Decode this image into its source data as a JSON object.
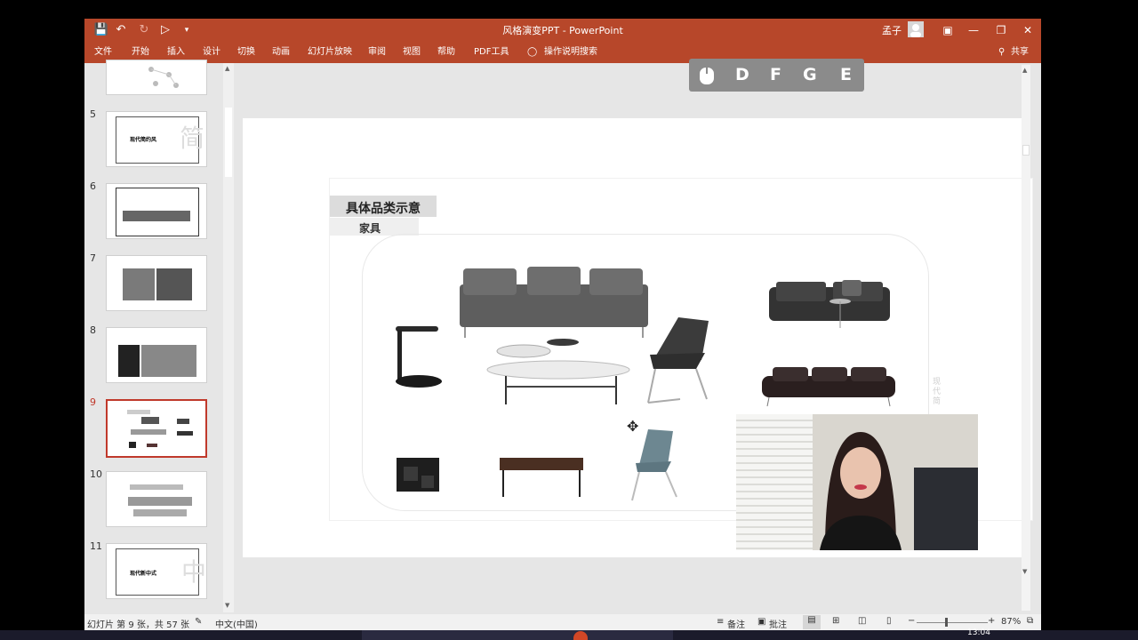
{
  "app": {
    "title": "风格演变PPT  -  PowerPoint",
    "user": "孟子",
    "share": "共享",
    "tell_me": "操作说明搜索"
  },
  "ribbon_tabs": [
    "文件",
    "开始",
    "插入",
    "设计",
    "切换",
    "动画",
    "幻灯片放映",
    "审阅",
    "视图",
    "帮助",
    "PDF工具"
  ],
  "thumbnails": [
    {
      "num": "",
      "title": ""
    },
    {
      "num": "5",
      "title": "现代简约风"
    },
    {
      "num": "6",
      "title": ""
    },
    {
      "num": "7",
      "title": ""
    },
    {
      "num": "8",
      "title": ""
    },
    {
      "num": "9",
      "title": ""
    },
    {
      "num": "10",
      "title": ""
    },
    {
      "num": "11",
      "title": "现代新中式"
    }
  ],
  "slide": {
    "heading": "具体品类示意",
    "subheading": "家具"
  },
  "key_overlay": {
    "keys": [
      "D",
      "F",
      "G",
      "E"
    ]
  },
  "statusbar": {
    "slide_info": "幻灯片 第 9 张，共 57 张",
    "language": "中文(中国)",
    "notes": "备注",
    "comments": "批注",
    "zoom": "87%"
  },
  "taskbar": {
    "time": "13:04"
  },
  "colors": {
    "accent": "#b7472a",
    "selected_thumb_border": "#c0392b"
  }
}
